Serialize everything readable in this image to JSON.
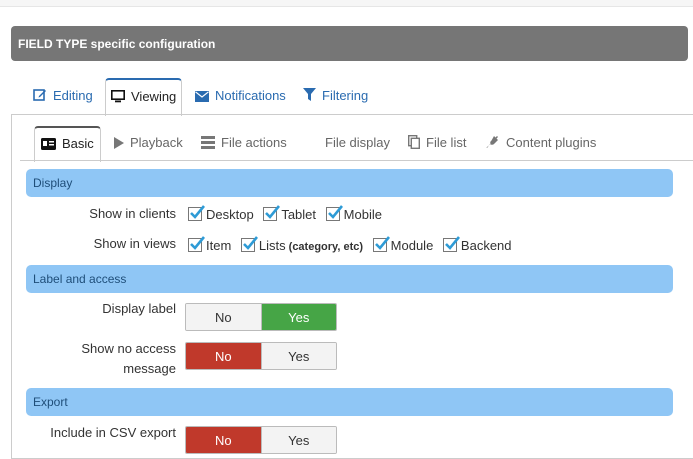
{
  "header": {
    "title": "FIELD TYPE specific configuration"
  },
  "tabs1": [
    {
      "label": "Editing",
      "icon": "edit-icon"
    },
    {
      "label": "Viewing",
      "icon": "monitor-icon"
    },
    {
      "label": "Notifications",
      "icon": "envelope-icon"
    },
    {
      "label": "Filtering",
      "icon": "filter-icon"
    }
  ],
  "active_tab1": "Viewing",
  "tabs2": [
    {
      "label": "Basic",
      "icon": "id-card-icon"
    },
    {
      "label": "Playback",
      "icon": "play-icon"
    },
    {
      "label": "File actions",
      "icon": "list-icon"
    },
    {
      "label": "File display",
      "icon": ""
    },
    {
      "label": "File list",
      "icon": "copy-icon"
    },
    {
      "label": "Content plugins",
      "icon": "plug-icon"
    }
  ],
  "active_tab2": "Basic",
  "sections": {
    "display": "Display",
    "label_access": "Label and access",
    "export": "Export"
  },
  "rows": {
    "show_in_clients": {
      "label": "Show in clients",
      "options": [
        {
          "label": "Desktop",
          "checked": true
        },
        {
          "label": "Tablet",
          "checked": true
        },
        {
          "label": "Mobile",
          "checked": true
        }
      ]
    },
    "show_in_views": {
      "label": "Show in views",
      "options": [
        {
          "label": "Item",
          "checked": true
        },
        {
          "label": "Lists",
          "note": "(category, etc)",
          "checked": true
        },
        {
          "label": "Module",
          "checked": true
        },
        {
          "label": "Backend",
          "checked": true
        }
      ]
    },
    "display_label": {
      "label": "Display label",
      "no": "No",
      "yes": "Yes",
      "selected": "Yes"
    },
    "show_no_access": {
      "label_line1": "Show no access",
      "label_line2": "message",
      "no": "No",
      "yes": "Yes",
      "selected": "No"
    },
    "csv_export": {
      "label": "Include in CSV export",
      "no": "No",
      "yes": "Yes",
      "selected": "No"
    }
  },
  "colors": {
    "accent_link": "#2a6bb0",
    "section_bg": "#8fc6f5",
    "yes_green": "#46a546",
    "no_red": "#c0392b",
    "header_bg": "#767676"
  }
}
